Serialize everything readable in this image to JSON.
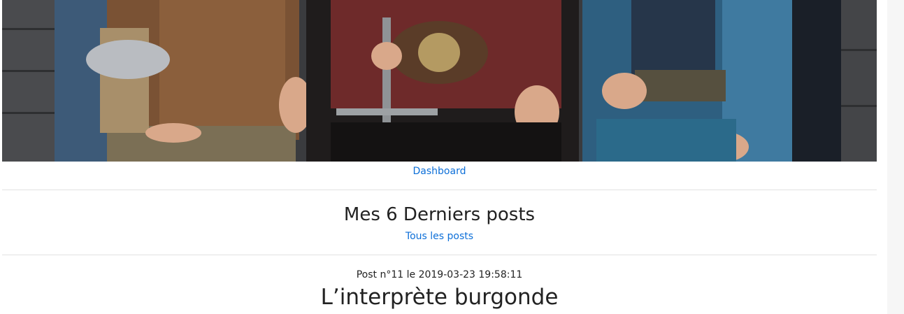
{
  "hero": {
    "alt": "Photo de groupe de personnages en costumes médiévaux"
  },
  "nav": {
    "dashboard_label": "Dashboard"
  },
  "latest": {
    "title": "Mes 6 Derniers posts",
    "all_posts_label": "Tous les posts"
  },
  "posts": [
    {
      "meta": "Post n°11 le 2019-03-23 19:58:11",
      "title": "L’interprète burgonde"
    }
  ]
}
